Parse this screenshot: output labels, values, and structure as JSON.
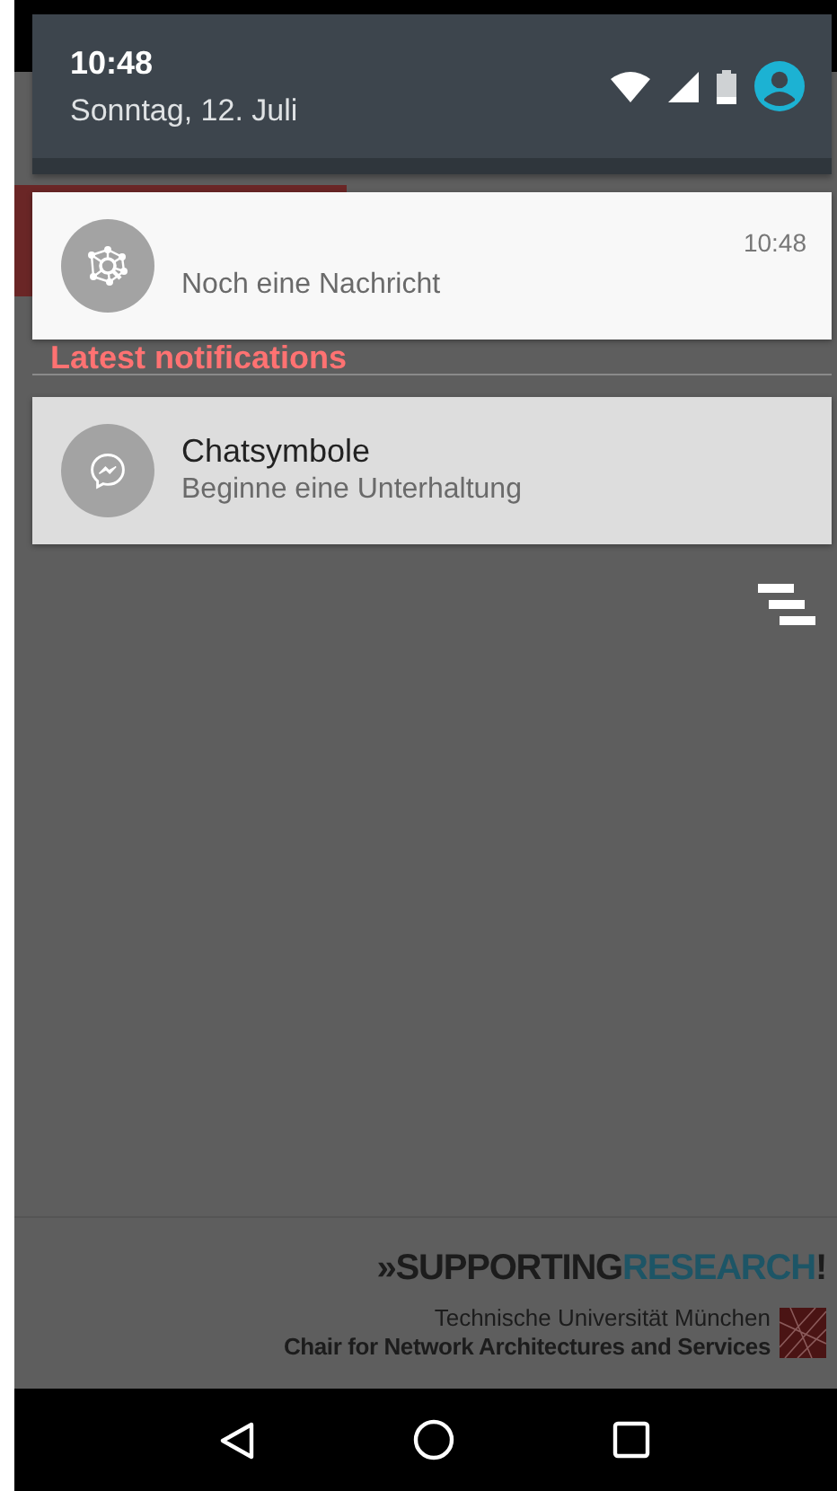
{
  "status_bar": {
    "time": "10:48",
    "date": "Sonntag, 12. Juli"
  },
  "app_behind": {
    "section_title": "Latest notifications",
    "slogan": [
      {
        "text": "»SUPPORTING",
        "color": "#1c1c1c"
      },
      {
        "text": "RESEARCH",
        "color": "#1d5566"
      },
      {
        "text": "!",
        "color": "#1c1c1c"
      }
    ],
    "university": "Technische Universität München",
    "chair": "Chair for Network Architectures and Services"
  },
  "notifications": [
    {
      "kind": "network",
      "text": "Noch eine Nachricht",
      "time": "10:48",
      "pressed": false
    },
    {
      "kind": "chat",
      "title": "Chatsymbole",
      "text": "Beginne eine Unterhaltung",
      "pressed": true
    }
  ]
}
